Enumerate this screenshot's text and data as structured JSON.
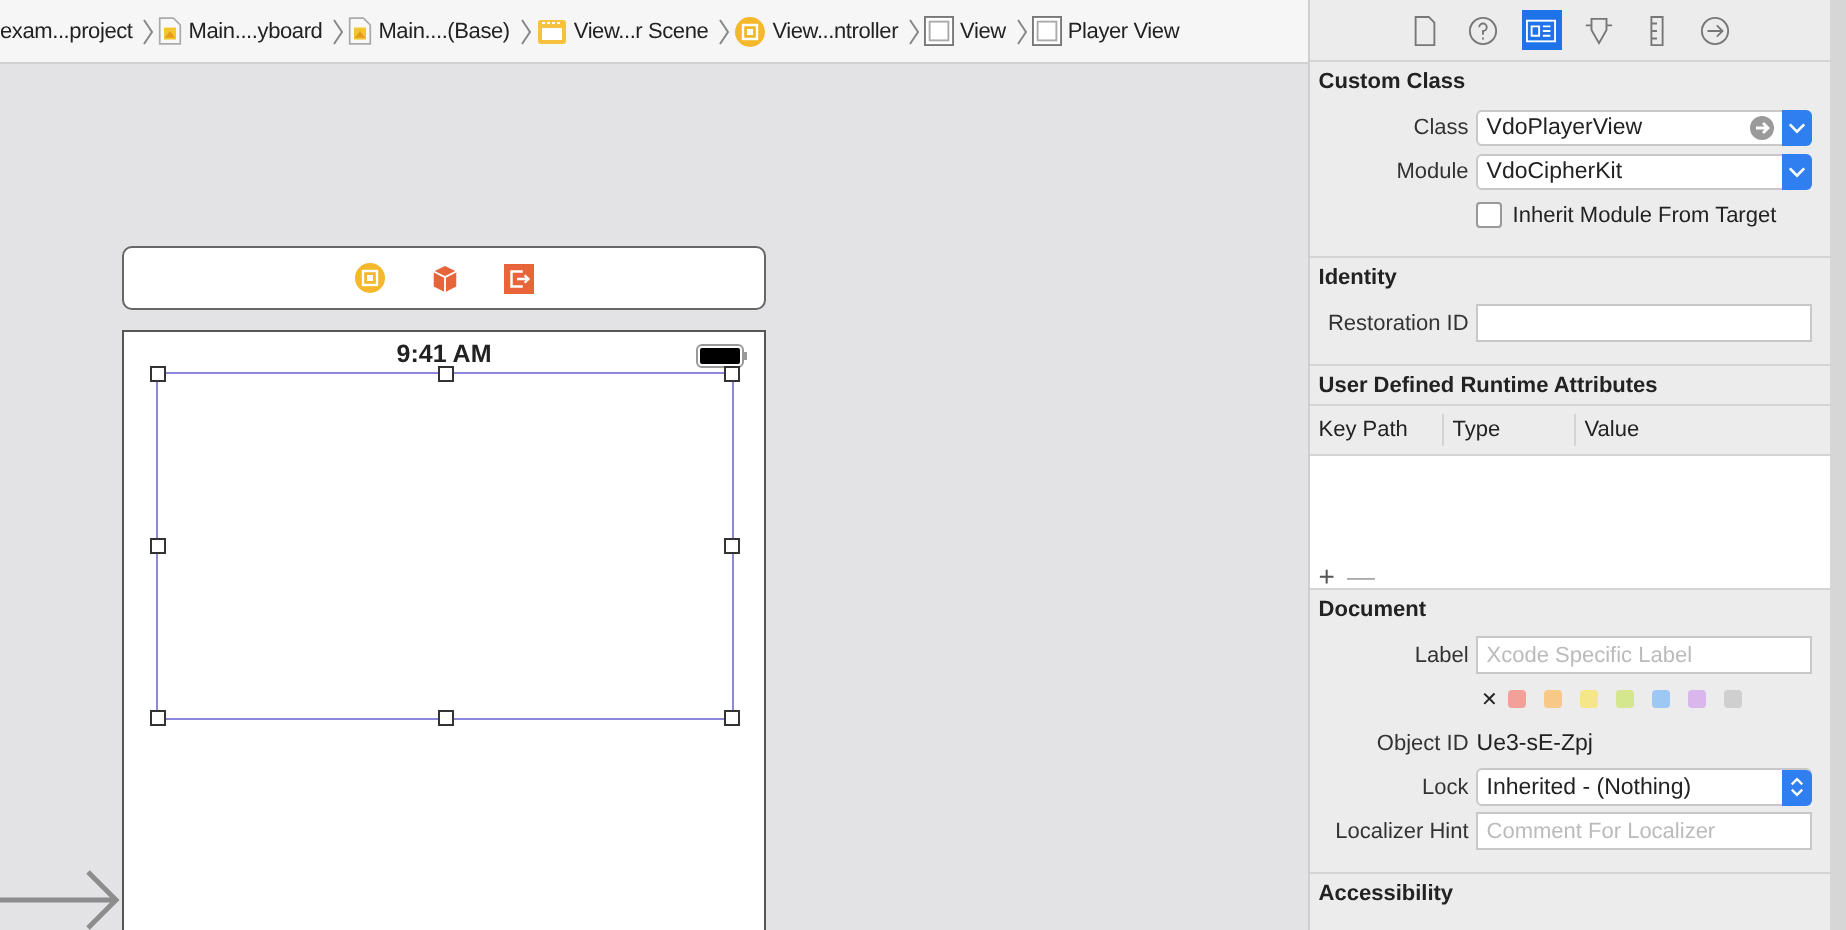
{
  "breadcrumb": [
    {
      "label": "exam...project",
      "kind": "none"
    },
    {
      "label": "Main....yboard",
      "kind": "file"
    },
    {
      "label": "Main....(Base)",
      "kind": "file"
    },
    {
      "label": "View...r Scene",
      "kind": "scene"
    },
    {
      "label": "View...ntroller",
      "kind": "controller"
    },
    {
      "label": "View",
      "kind": "view"
    },
    {
      "label": "Player View",
      "kind": "view"
    }
  ],
  "canvas": {
    "status_time": "9:41 AM",
    "dock_icons": [
      {
        "kind": "controller"
      },
      {
        "kind": "cube"
      },
      {
        "kind": "exit"
      }
    ]
  },
  "inspector_tabs": [
    {
      "kind": "file",
      "selected": false
    },
    {
      "kind": "help",
      "selected": false
    },
    {
      "kind": "identity",
      "selected": true
    },
    {
      "kind": "attributes",
      "selected": false
    },
    {
      "kind": "size",
      "selected": false
    },
    {
      "kind": "connections",
      "selected": false
    }
  ],
  "custom_class": {
    "title": "Custom Class",
    "class_label": "Class",
    "class_value": "VdoPlayerView",
    "module_label": "Module",
    "module_value": "VdoCipherKit",
    "inherit_label": "Inherit Module From Target",
    "inherit_checked": false
  },
  "identity": {
    "title": "Identity",
    "restoration_label": "Restoration ID"
  },
  "runtime_attributes": {
    "title": "User Defined Runtime Attributes",
    "columns": [
      "Key Path",
      "Type",
      "Value"
    ],
    "add": "+",
    "remove": "—"
  },
  "document": {
    "title": "Document",
    "label_label": "Label",
    "label_placeholder": "Xcode Specific Label",
    "clear": "✕",
    "label_colors": [
      {
        "color": "#f2a09a"
      },
      {
        "color": "#f7c986"
      },
      {
        "color": "#f5e68a"
      },
      {
        "color": "#d5e78e"
      },
      {
        "color": "#9dc8f4"
      },
      {
        "color": "#d9b6ec"
      },
      {
        "color": "#cfcfcf"
      }
    ],
    "object_id_label": "Object ID",
    "object_id": "Ue3-sE-Zpj",
    "lock_label": "Lock",
    "lock_value": "Inherited - (Nothing)",
    "hint_label": "Localizer Hint",
    "hint_placeholder": "Comment For Localizer"
  },
  "accessibility": {
    "title": "Accessibility"
  }
}
